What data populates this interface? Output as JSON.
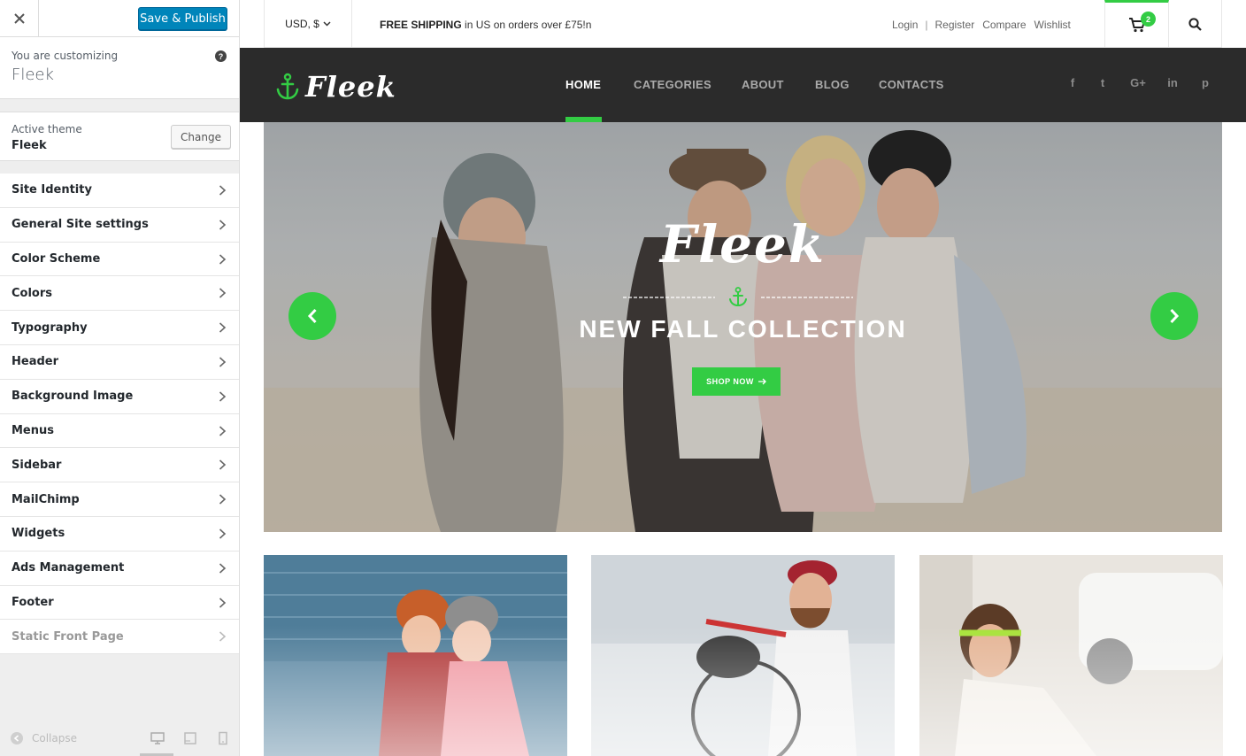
{
  "customizer": {
    "save_label": "Save & Publish",
    "customizing_label": "You are customizing",
    "site_name": "Fleek",
    "help_icon": "?",
    "active_theme_label": "Active theme",
    "active_theme_name": "Fleek",
    "change_label": "Change",
    "sections": [
      "Site Identity",
      "General Site settings",
      "Color Scheme",
      "Colors",
      "Typography",
      "Header",
      "Background Image",
      "Menus",
      "Sidebar",
      "MailChimp",
      "Widgets",
      "Ads Management",
      "Footer",
      "Static Front Page"
    ],
    "collapse_label": "Collapse",
    "accent_color": "#0085ba"
  },
  "site": {
    "currency": "USD, $",
    "shipping_bold": "FREE SHIPPING",
    "shipping_rest": " in US on orders over £75!n",
    "account_links": {
      "login": "Login",
      "separator": "|",
      "register": "Register",
      "compare": "Compare",
      "wishlist": "Wishlist"
    },
    "cart_count": "2",
    "logo_text": "Fleek",
    "nav": [
      "HOME",
      "CATEGORIES",
      "ABOUT",
      "BLOG",
      "CONTACTS"
    ],
    "active_nav": "HOME",
    "social_icons": [
      "facebook-icon",
      "twitter-icon",
      "google-plus-icon",
      "linkedin-icon",
      "pinterest-icon"
    ],
    "social_glyphs": [
      "f",
      "t",
      "G+",
      "in",
      "p"
    ],
    "accent_color": "#33cc44",
    "hero": {
      "title": "Fleek",
      "subtitle": "NEW FALL COLLECTION",
      "button": "SHOP NOW"
    }
  }
}
